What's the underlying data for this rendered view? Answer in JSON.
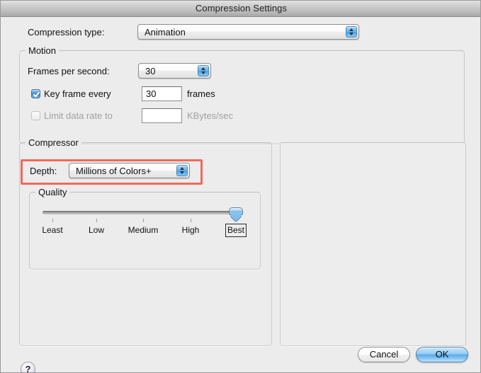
{
  "window": {
    "title": "Compression Settings"
  },
  "compression_type": {
    "label": "Compression type:",
    "value": "Animation"
  },
  "motion": {
    "title": "Motion",
    "fps": {
      "label": "Frames per second:",
      "value": "30"
    },
    "key_frame": {
      "label": "Key frame every",
      "value": "30",
      "unit": "frames",
      "checked": true
    },
    "limit_data_rate": {
      "label": "Limit data rate to",
      "value": "",
      "unit": "KBytes/sec",
      "checked": false,
      "enabled": false
    }
  },
  "compressor": {
    "title": "Compressor",
    "depth": {
      "label": "Depth:",
      "value": "Millions of Colors+"
    },
    "quality": {
      "title": "Quality",
      "ticks": [
        "Least",
        "Low",
        "Medium",
        "High",
        "Best"
      ],
      "selected": "Best"
    }
  },
  "buttons": {
    "help": "?",
    "cancel": "Cancel",
    "ok": "OK"
  },
  "colors": {
    "annotation": "#ef6a5a",
    "accent_blue": "#5aaae9",
    "window_bg": "#ececec"
  }
}
